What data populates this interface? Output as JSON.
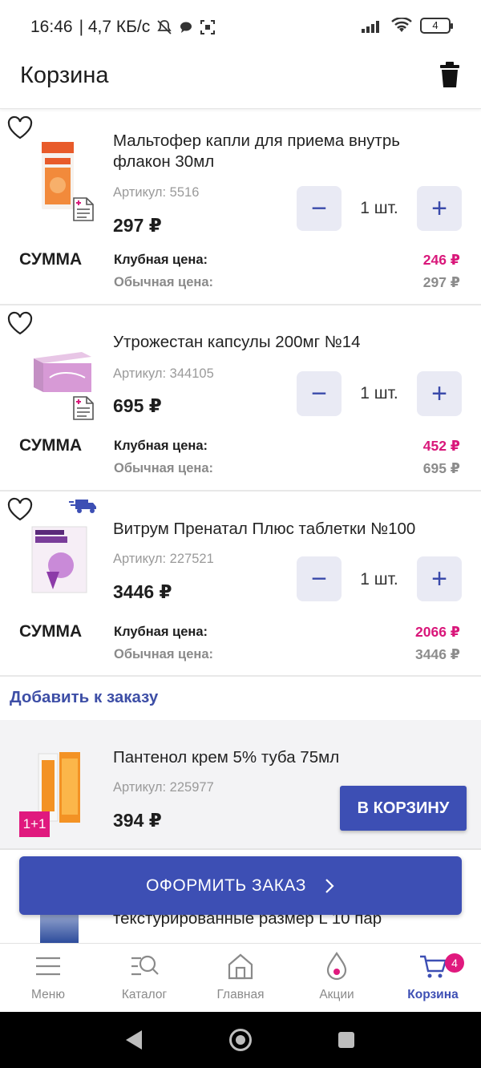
{
  "status_bar": {
    "time": "16:46",
    "speed": "| 4,7 КБ/с",
    "battery": "4"
  },
  "header": {
    "title": "Корзина"
  },
  "cart": {
    "items": [
      {
        "name": "Мальтофер капли для приема внутрь флакон 30мл",
        "sku": "Артикул: 5516",
        "price": "297 ₽",
        "qty": "1 шт.",
        "sum_label": "СУММА",
        "club_label": "Клубная цена:",
        "club_price": "246 ₽",
        "regular_label": "Обычная цена:",
        "regular_price": "297 ₽"
      },
      {
        "name": "Утрожестан капсулы 200мг №14",
        "sku": "Артикул: 344105",
        "price": "695 ₽",
        "qty": "1 шт.",
        "sum_label": "СУММА",
        "club_label": "Клубная цена:",
        "club_price": "452 ₽",
        "regular_label": "Обычная цена:",
        "regular_price": "695 ₽"
      },
      {
        "name": "Витрум Пренатал Плюс таблетки №100",
        "sku": "Артикул: 227521",
        "price": "3446 ₽",
        "qty": "1 шт.",
        "sum_label": "СУММА",
        "club_label": "Клубная цена:",
        "club_price": "2066 ₽",
        "regular_label": "Обычная цена:",
        "regular_price": "3446 ₽"
      }
    ]
  },
  "add_to_order": {
    "title": "Добавить к заказу",
    "product": {
      "name": "Пантенол крем 5% туба 75мл",
      "sku": "Артикул: 225977",
      "price": "394 ₽",
      "badge": "1+1",
      "button": "В КОРЗИНУ"
    },
    "peek_text": "текстурированные размер L 10 пар"
  },
  "checkout": {
    "label": "ОФОРМИТЬ ЗАКАЗ"
  },
  "bottom_nav": {
    "items": [
      {
        "label": "Меню",
        "icon": "menu-icon"
      },
      {
        "label": "Каталог",
        "icon": "catalog-search-icon"
      },
      {
        "label": "Главная",
        "icon": "home-icon"
      },
      {
        "label": "Акции",
        "icon": "promo-drop-icon"
      },
      {
        "label": "Корзина",
        "icon": "cart-icon"
      }
    ],
    "cart_badge": "4"
  },
  "colors": {
    "accent": "#3d4fb4",
    "club_price": "#d9177a",
    "promo_badge": "#e0197e"
  }
}
